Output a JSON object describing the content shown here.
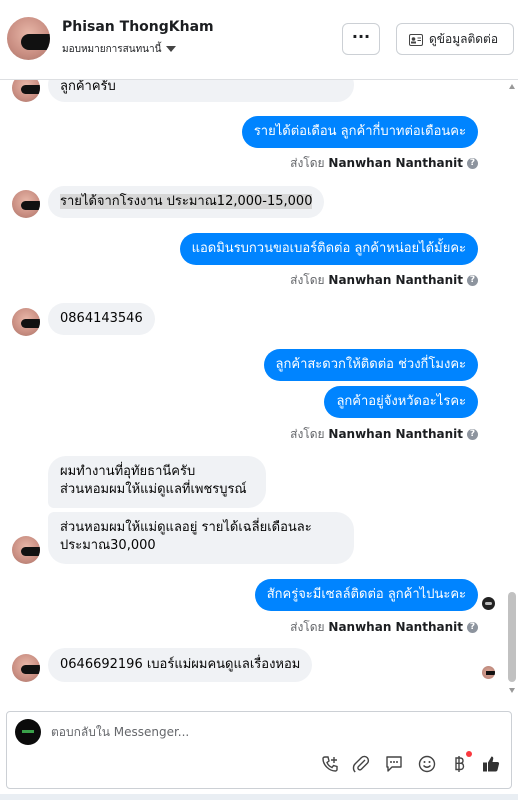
{
  "header": {
    "name": "Phisan ThongKham",
    "assignment": "มอบหมายการสนทนานี้",
    "more_label": "···",
    "contact_button": "ดูข้อมูลติดต่อ"
  },
  "messages": [
    {
      "dir": "in",
      "text": "ลูกค้าครับ"
    },
    {
      "dir": "out",
      "text": "รายได้ต่อเดือน ลูกค้ากี่บาทต่อเดือนคะ"
    },
    {
      "dir": "sent_by",
      "prefix": "ส่งโดย",
      "name": "Nanwhan Nanthanit",
      "help": "?"
    },
    {
      "dir": "in",
      "text": "รายได้จากโรงงาน ประมาณ12,000-15,000"
    },
    {
      "dir": "out",
      "text": "แอดมินรบกวนขอเบอร์ติดต่อ ลูกค้าหน่อยได้มั้ยคะ"
    },
    {
      "dir": "sent_by",
      "prefix": "ส่งโดย",
      "name": "Nanwhan Nanthanit",
      "help": "?"
    },
    {
      "dir": "in",
      "text": "0864143546"
    },
    {
      "dir": "out",
      "text": "ลูกค้าสะดวกให้ติดต่อ ช่วงกี่โมงคะ"
    },
    {
      "dir": "out",
      "text": "ลูกค้าอยู่จังหวัดอะไรคะ"
    },
    {
      "dir": "sent_by",
      "prefix": "ส่งโดย",
      "name": "Nanwhan Nanthanit",
      "help": "?"
    },
    {
      "dir": "in",
      "lines": [
        "ผมทำงานที่อุทัยธานีครับ",
        "ส่วนหอมผมให้แม่ดูแลที่เพชรบูรณ์"
      ]
    },
    {
      "dir": "in",
      "lines": [
        "ส่วนหอมผมให้แม่ดูแลอยู่ รายได้เฉลี่ยเดือนละ",
        "ประมาณ30,000"
      ]
    },
    {
      "dir": "out",
      "text": "สักครู่จะมีเซลล์ติดต่อ ลูกค้าไปนะคะ"
    },
    {
      "dir": "sent_by",
      "prefix": "ส่งโดย",
      "name": "Nanwhan Nanthanit",
      "help": "?"
    },
    {
      "dir": "in",
      "text": "0646692196 เบอร์แม่ผมคนดูแลเรื่องหอม"
    }
  ],
  "composer": {
    "placeholder": "ตอบกลับใน Messenger..."
  },
  "toolbar_icons": [
    "call-add-icon",
    "attachment-icon",
    "saved-reply-icon",
    "emoji-icon",
    "baht-payment-icon",
    "thumbs-up-icon"
  ]
}
